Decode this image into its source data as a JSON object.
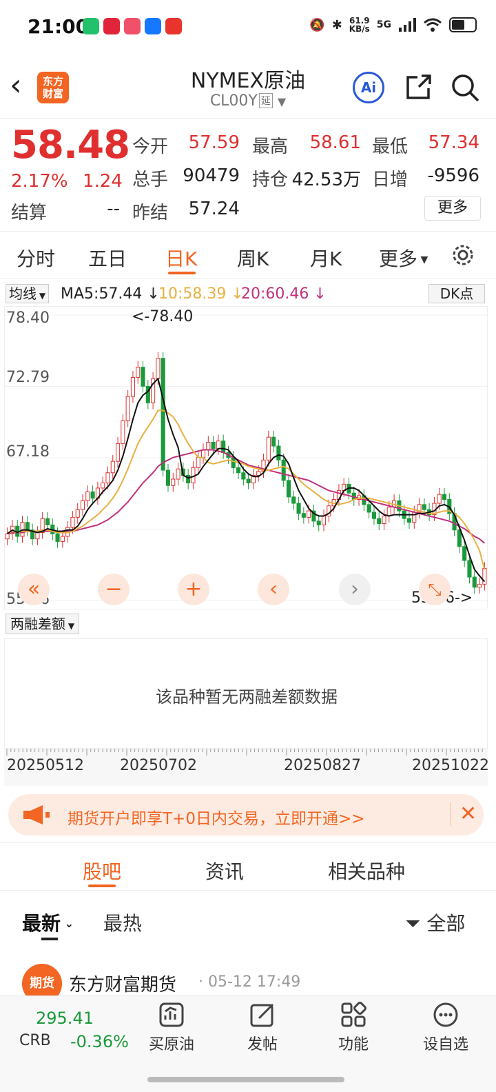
{
  "status": {
    "time": "21:00",
    "net_speed": "61.9",
    "net_unit": "KB/s",
    "network": "5G"
  },
  "nav": {
    "back_symbol": "‹",
    "logo_text": "东方\n财富",
    "title": "NYMEX原油",
    "subtitle": "CL00Y",
    "delay_tag": "延",
    "ai_label": "Ai"
  },
  "quote": {
    "price": "58.48",
    "change_pct": "2.17%",
    "change": "1.24",
    "settle_label": "结算",
    "settle_value": "--",
    "fields": [
      {
        "label": "今开",
        "value": "57.59"
      },
      {
        "label": "最高",
        "value": "58.61"
      },
      {
        "label": "最低",
        "value": "57.34"
      },
      {
        "label": "总手",
        "value": "90479"
      },
      {
        "label": "持仓",
        "value": "42.53万"
      },
      {
        "label": "日增",
        "value": "-9596"
      },
      {
        "label": "昨结",
        "value": "57.24"
      }
    ],
    "more_label": "更多"
  },
  "tabs": [
    "分时",
    "五日",
    "日K",
    "周K",
    "月K",
    "更多"
  ],
  "active_tab": "日K",
  "ma_row": {
    "selector": "均线",
    "ma5": "MA5:57.44 ↓",
    "ma10": "10:58.39 ↓",
    "ma20": "20:60.46 ↓",
    "dk_label": "DK点"
  },
  "chart_data": {
    "type": "candlestick",
    "y_ticks": [
      "78.40",
      "72.79",
      "67.18",
      "55.96"
    ],
    "ylim": [
      55.96,
      78.4
    ],
    "high_marker": "<-78.40",
    "low_marker": "55.96->",
    "x_ticks": [
      "20250512",
      "20250702",
      "20250827",
      "20251022"
    ],
    "close_series": [
      61.2,
      61.8,
      61.0,
      62.1,
      61.5,
      60.8,
      61.3,
      62.4,
      61.9,
      61.2,
      60.6,
      61.0,
      61.7,
      62.5,
      63.1,
      63.8,
      64.5,
      64.0,
      64.8,
      65.2,
      66.0,
      66.9,
      68.3,
      70.1,
      72.0,
      73.5,
      74.3,
      72.8,
      71.5,
      73.4,
      75.0,
      66.2,
      65.0,
      65.5,
      66.3,
      65.8,
      65.2,
      66.4,
      67.2,
      67.8,
      68.4,
      67.9,
      68.5,
      67.6,
      67.2,
      66.4,
      66.0,
      65.5,
      65.2,
      65.8,
      66.1,
      67.0,
      68.8,
      68.1,
      67.0,
      65.4,
      64.1,
      63.6,
      62.8,
      62.5,
      63.0,
      62.2,
      61.9,
      62.6,
      63.4,
      63.9,
      64.6,
      65.1,
      64.4,
      63.9,
      64.2,
      63.5,
      62.9,
      62.4,
      62.0,
      62.6,
      63.3,
      63.8,
      63.0,
      62.4,
      62.1,
      62.9,
      63.5,
      63.1,
      62.7,
      63.6,
      64.3,
      63.9,
      62.8,
      61.5,
      60.2,
      59.1,
      57.8,
      57.0,
      57.24,
      58.48
    ],
    "ma5": [
      61.2,
      61.5,
      61.3,
      61.5,
      61.5,
      61.4,
      61.3,
      61.4,
      61.6,
      61.5,
      61.4,
      61.4,
      61.5,
      61.5,
      61.8,
      62.4,
      63.1,
      63.6,
      64.0,
      64.5,
      64.9,
      65.4,
      66.2,
      67.3,
      68.7,
      70.2,
      71.5,
      72.1,
      72.4,
      73.0,
      73.4,
      71.8,
      70.2,
      69.0,
      68.0,
      65.8,
      65.6,
      65.7,
      65.9,
      66.5,
      67.0,
      67.5,
      67.9,
      67.9,
      67.8,
      67.3,
      66.9,
      66.3,
      65.9,
      65.7,
      65.7,
      66.0,
      66.7,
      67.2,
      67.4,
      67.3,
      66.7,
      65.6,
      64.6,
      63.9,
      63.2,
      62.8,
      62.6,
      62.6,
      62.8,
      63.2,
      63.9,
      64.6,
      64.8,
      64.8,
      64.6,
      64.2,
      63.8,
      63.4,
      63.0,
      62.7,
      62.6,
      62.7,
      62.7,
      62.7,
      62.7,
      62.7,
      62.8,
      62.8,
      62.9,
      63.0,
      63.4,
      63.5,
      63.3,
      62.7,
      61.7,
      60.7,
      59.5,
      58.4,
      57.9,
      57.44
    ],
    "ma10": [
      61.2,
      61.4,
      61.3,
      61.4,
      61.4,
      61.4,
      61.4,
      61.5,
      61.5,
      61.4,
      61.3,
      61.3,
      61.3,
      61.4,
      61.6,
      61.8,
      62.1,
      62.4,
      62.7,
      63.1,
      63.5,
      64.0,
      64.6,
      65.4,
      66.3,
      67.3,
      68.3,
      69.0,
      69.6,
      70.2,
      70.9,
      70.9,
      70.7,
      70.4,
      69.8,
      69.0,
      68.3,
      67.7,
      67.2,
      67.2,
      66.8,
      66.7,
      66.8,
      66.9,
      67.0,
      66.9,
      66.8,
      66.7,
      66.5,
      66.4,
      66.3,
      66.2,
      66.2,
      66.3,
      66.4,
      66.5,
      66.3,
      65.9,
      65.5,
      65.1,
      64.8,
      64.5,
      64.2,
      63.9,
      63.7,
      63.6,
      63.5,
      63.6,
      63.7,
      63.9,
      64.0,
      64.0,
      64.0,
      63.9,
      63.8,
      63.7,
      63.6,
      63.5,
      63.4,
      63.3,
      63.2,
      63.1,
      63.0,
      62.9,
      62.8,
      62.8,
      62.9,
      63.0,
      63.0,
      62.8,
      62.5,
      62.0,
      61.4,
      60.7,
      59.9,
      58.39
    ],
    "ma20": [
      61.2,
      61.3,
      61.3,
      61.3,
      61.4,
      61.4,
      61.4,
      61.4,
      61.4,
      61.4,
      61.4,
      61.4,
      61.4,
      61.4,
      61.5,
      61.6,
      61.7,
      61.8,
      61.9,
      62.1,
      62.3,
      62.6,
      62.9,
      63.3,
      63.7,
      64.2,
      64.7,
      65.2,
      65.6,
      66.0,
      66.5,
      66.8,
      67.0,
      67.2,
      67.3,
      67.4,
      67.5,
      67.6,
      67.7,
      67.8,
      67.8,
      67.8,
      67.7,
      67.6,
      67.4,
      67.2,
      67.0,
      66.8,
      66.6,
      66.5,
      66.4,
      66.3,
      66.2,
      66.1,
      66.0,
      65.9,
      65.8,
      65.7,
      65.6,
      65.5,
      65.4,
      65.2,
      65.0,
      64.8,
      64.6,
      64.5,
      64.4,
      64.3,
      64.2,
      64.1,
      64.0,
      63.9,
      63.8,
      63.7,
      63.6,
      63.5,
      63.4,
      63.3,
      63.2,
      63.1,
      63.0,
      62.9,
      62.8,
      62.7,
      62.6,
      62.5,
      62.4,
      62.3,
      62.2,
      62.0,
      61.8,
      61.6,
      61.3,
      61.0,
      60.8,
      60.46
    ],
    "colors": {
      "up": "#e02f2f",
      "down": "#1a9a3a",
      "ma5": "#111111",
      "ma10": "#e8b040",
      "ma20": "#c0307a"
    }
  },
  "chart_controls": [
    "«",
    "−",
    "+",
    "‹",
    "›",
    "⤡"
  ],
  "sub_chart": {
    "selector": "两融差额",
    "empty_message": "该品种暂无两融差额数据"
  },
  "promo": {
    "text": "期货开户即享T+0日内交易，立即开通>>",
    "close": "✕"
  },
  "section_tabs": [
    "股吧",
    "资讯",
    "相关品种"
  ],
  "filters": {
    "latest": "最新",
    "hot": "最热",
    "all": "全部"
  },
  "post": {
    "avatar_text": "期货",
    "author": "东方财富期货",
    "time": "· 05-12 17:49"
  },
  "bottom": {
    "index_value": "295.41",
    "index_name": "CRB",
    "index_pct": "-0.36%",
    "items": [
      "买原油",
      "发帖",
      "功能",
      "设自选"
    ]
  }
}
